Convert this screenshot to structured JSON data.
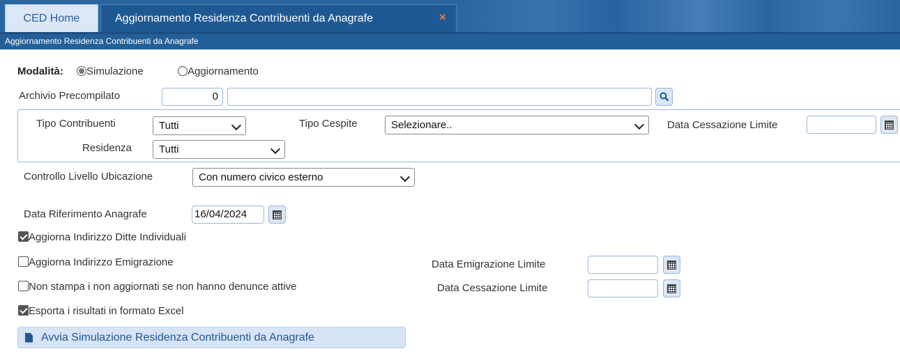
{
  "tabs": [
    {
      "label": "CED Home"
    },
    {
      "label": "Aggiornamento Residenza Contribuenti da Anagrafe",
      "close": "×"
    }
  ],
  "subheader": {
    "title": "Aggiornamento Residenza Contribuenti da Anagrafe"
  },
  "modalita": {
    "label": "Modalità:",
    "options": [
      "Simulazione",
      "Aggiornamento"
    ],
    "selected": "Simulazione"
  },
  "archivio": {
    "label": "Archivio Precompilato",
    "code": "0",
    "description": ""
  },
  "filters": {
    "tipo_contribuenti": {
      "label": "Tipo Contribuenti",
      "value": "Tutti"
    },
    "tipo_cespite": {
      "label": "Tipo Cespite",
      "value": "Selezionare.."
    },
    "data_cessazione": {
      "label": "Data Cessazione Limite",
      "value": ""
    },
    "residenza": {
      "label": "Residenza",
      "value": "Tutti"
    }
  },
  "controllo": {
    "label": "Controllo Livello Ubicazione",
    "value": "Con numero civico esterno"
  },
  "data_riferimento": {
    "label": "Data Riferimento Anagrafe",
    "value": "16/04/2024"
  },
  "options": {
    "ditte": {
      "label": "Aggiorna Indirizzo Ditte Individuali",
      "checked": true
    },
    "emigrazione": {
      "label": "Aggiorna Indirizzo Emigrazione",
      "checked": false
    },
    "non_stampa": {
      "label": "Non stampa i non aggiornati se non hanno denunce attive",
      "checked": false
    },
    "excel": {
      "label": "Esporta i risultati in formato Excel",
      "checked": true
    }
  },
  "data_emigrazione": {
    "label": "Data Emigrazione Limite",
    "value": ""
  },
  "data_cessazione_2": {
    "label": "Data Cessazione Limite",
    "value": ""
  },
  "run_button": {
    "label": "Avvia Simulazione Residenza Contribuenti da Anagrafe"
  },
  "colors": {
    "header": "#2a65a0",
    "accent_close": "#f07a2a",
    "button_bg": "#d6e4f5"
  }
}
